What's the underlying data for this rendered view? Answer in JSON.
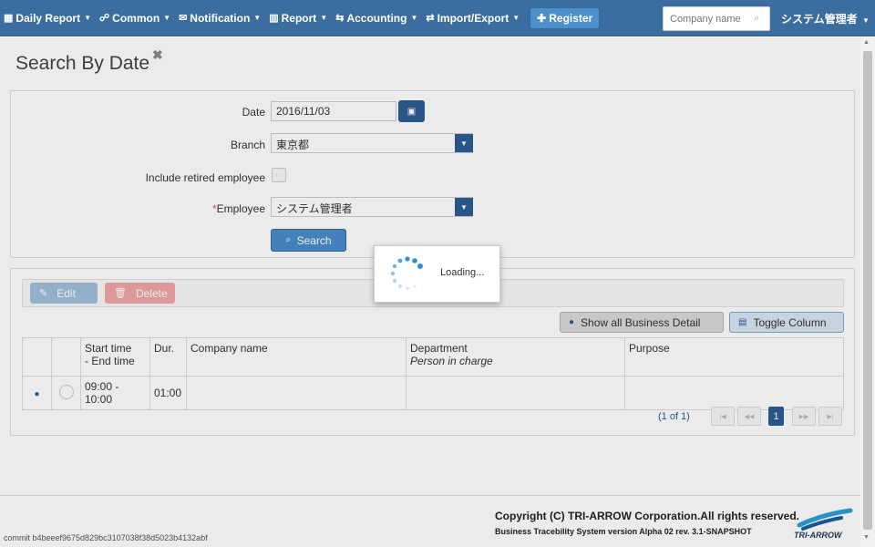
{
  "nav": {
    "items": [
      {
        "icon": "calendar-icon",
        "glyph": "▦",
        "label": "Daily Report"
      },
      {
        "icon": "users-icon",
        "glyph": "☍",
        "label": "Common"
      },
      {
        "icon": "envelope-icon",
        "glyph": "✉",
        "label": "Notification"
      },
      {
        "icon": "bar-chart-icon",
        "glyph": "▥",
        "label": "Report"
      },
      {
        "icon": "exchange-icon",
        "glyph": "⇆",
        "label": "Accounting"
      },
      {
        "icon": "transfer-icon",
        "glyph": "⇄",
        "label": "Import/Export"
      }
    ],
    "register_label": "Register",
    "search_placeholder": "Company name",
    "user": "システム管理者"
  },
  "page": {
    "title": "Search By Date"
  },
  "form": {
    "date_label": "Date",
    "date_value": "2016/11/03",
    "branch_label": "Branch",
    "branch_value": "東京都",
    "retired_label": "Include retired employee",
    "employee_required": "*",
    "employee_label": "Employee",
    "employee_value": "システム管理者",
    "search_label": "Search"
  },
  "toolbar": {
    "edit_label": "Edit",
    "delete_label": "Delete"
  },
  "actions": {
    "show_detail_label": "Show all Business Detail",
    "toggle_column_label": "Toggle Column"
  },
  "table": {
    "headers": {
      "time_line1": "Start time",
      "time_line2": "- End time",
      "dur": "Dur.",
      "company": "Company name",
      "department": "Department",
      "person": "Person in charge",
      "purpose": "Purpose"
    },
    "rows": [
      {
        "time": "09:00 - 10:00",
        "dur": "01:00",
        "company": "",
        "department": "",
        "purpose": ""
      }
    ]
  },
  "pager": {
    "text": "(1 of 1)",
    "current": "1"
  },
  "loading": {
    "text": "Loading..."
  },
  "footer": {
    "commit": "commit b4beeef9675d829bc3107038f38d5023b4132abf",
    "copyright": "Copyright (C) TRI-ARROW Corporation.All rights reserved.",
    "version": "Business Tracebility System version Alpha 02 rev. 3.1-SNAPSHOT",
    "logo": "TRI-ARROW"
  }
}
